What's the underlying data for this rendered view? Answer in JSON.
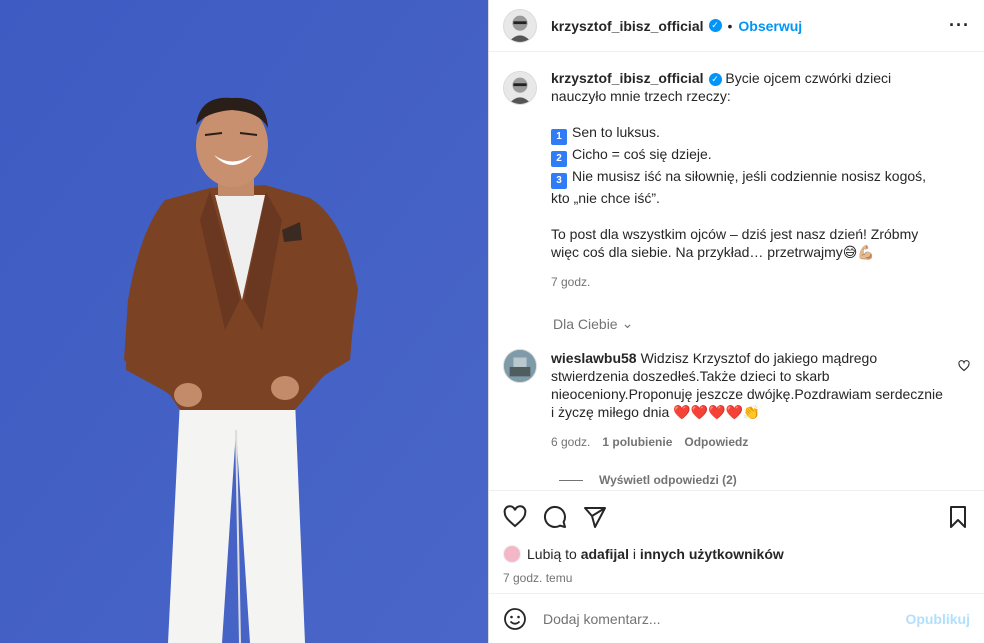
{
  "post": {
    "photo_alt": "Mężczyzna w brązowej marynarce i białych spodniach na niebieskim tle"
  },
  "header": {
    "username": "krzysztof_ibisz_official",
    "dot": "•",
    "follow_label": "Obserwuj",
    "more_label": "···"
  },
  "caption": {
    "username": "krzysztof_ibisz_official",
    "intro": "Bycie ojcem czwórki dzieci nauczyło mnie trzech rzeczy:",
    "items": [
      {
        "num": "1",
        "text": "Sen to luksus."
      },
      {
        "num": "2",
        "text": "Cicho = coś się dzieje."
      },
      {
        "num": "3",
        "text": "Nie musisz iść na siłownię, jeśli codziennie nosisz kogoś, kto „nie chce iść”."
      }
    ],
    "outro": "To post dla wszystkim ojców – dziś jest nasz dzień! Zróbmy więc coś dla siebie. Na przykład… przetrwajmy😅💪🏼",
    "time": "7 godz."
  },
  "for_you": {
    "label": "Dla Ciebie",
    "chevron": "⌄"
  },
  "comment": {
    "username": "wieslawbu58",
    "text": "Widzisz Krzysztof do jakiego mądrego stwierdzenia doszedłeś.Także dzieci to skarb nieoceniony.Proponuję jeszcze dwójkę.Pozdrawiam serdecznie i życzę miłego dnia ❤️❤️❤️❤️👏",
    "time": "6 godz.",
    "likes": "1 polubienie",
    "reply": "Odpowiedz",
    "view_replies": "Wyświetl odpowiedzi (2)"
  },
  "actions": {
    "icons": [
      "heart-icon",
      "comment-icon",
      "share-icon",
      "bookmark-icon"
    ],
    "likes_prefix": "Lubią to ",
    "likes_user": "adafijal",
    "likes_middle": " i ",
    "likes_rest": "innych użytkowników",
    "time": "7 godz. temu"
  },
  "add_comment": {
    "placeholder": "Dodaj komentarz...",
    "publish": "Opublikuj"
  },
  "colors": {
    "accent": "#0095f6",
    "background_photo": "#3f5fc0",
    "muted": "#737373"
  }
}
